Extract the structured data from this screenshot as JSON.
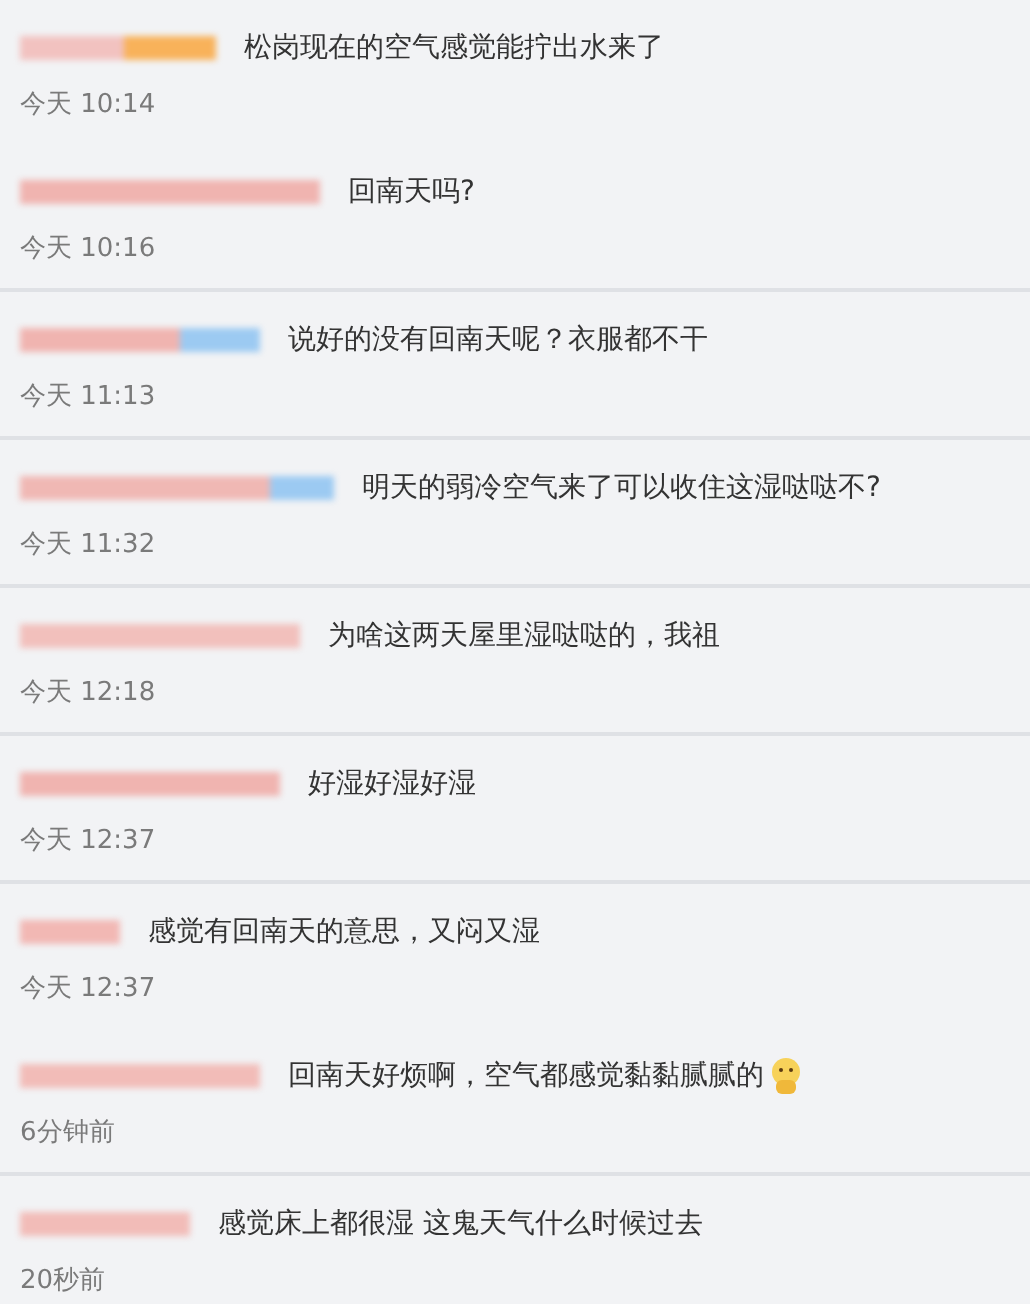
{
  "comment_groups": [
    {
      "comments": [
        {
          "text": "松岗现在的空气感觉能拧出水来了",
          "time": "今天 10:14",
          "emoji": false
        },
        {
          "text": "回南天吗?",
          "time": "今天 10:16",
          "emoji": false
        }
      ]
    },
    {
      "comments": [
        {
          "text": "说好的没有回南天呢？衣服都不干",
          "time": "今天 11:13",
          "emoji": false
        }
      ]
    },
    {
      "comments": [
        {
          "text": "明天的弱冷空气来了可以收住这湿哒哒不?",
          "time": "今天 11:32",
          "emoji": false
        }
      ]
    },
    {
      "comments": [
        {
          "text": "为啥这两天屋里湿哒哒的，我祖",
          "time": "今天 12:18",
          "emoji": false
        }
      ]
    },
    {
      "comments": [
        {
          "text": "好湿好湿好湿",
          "time": "今天 12:37",
          "emoji": false
        }
      ]
    },
    {
      "comments": [
        {
          "text": "感觉有回南天的意思，又闷又湿",
          "time": "今天 12:37",
          "emoji": false
        },
        {
          "text": "回南天好烦啊，空气都感觉黏黏腻腻的",
          "time": "6分钟前",
          "emoji": true
        }
      ]
    },
    {
      "comments": [
        {
          "text": "感觉床上都很湿 这鬼天气什么时候过去",
          "time": "20秒前",
          "emoji": false
        }
      ]
    }
  ]
}
